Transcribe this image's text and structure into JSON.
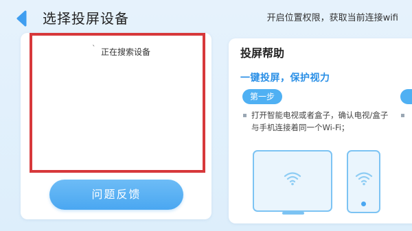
{
  "header": {
    "title": "选择投屏设备",
    "permission_link": "开启位置权限，获取当前连接wifi"
  },
  "device_list": {
    "spinner_glyph": "`",
    "status_text": "正在搜索设备"
  },
  "feedback": {
    "label": "问题反馈"
  },
  "help": {
    "title": "投屏帮助",
    "subtitle": "一键投屏，保护视力",
    "steps": [
      {
        "label": "第一步",
        "text": "打开智能电视或者盒子，确认电视/盒子与手机连接着同一个Wi-Fi；"
      }
    ]
  },
  "colors": {
    "accent": "#4aa7f1",
    "highlight_border": "#d7383b",
    "subtitle": "#2a8fe6",
    "background": "#e2f0fb"
  },
  "icons": {
    "back": "chevron-left-icon",
    "wifi": "wifi-icon"
  }
}
